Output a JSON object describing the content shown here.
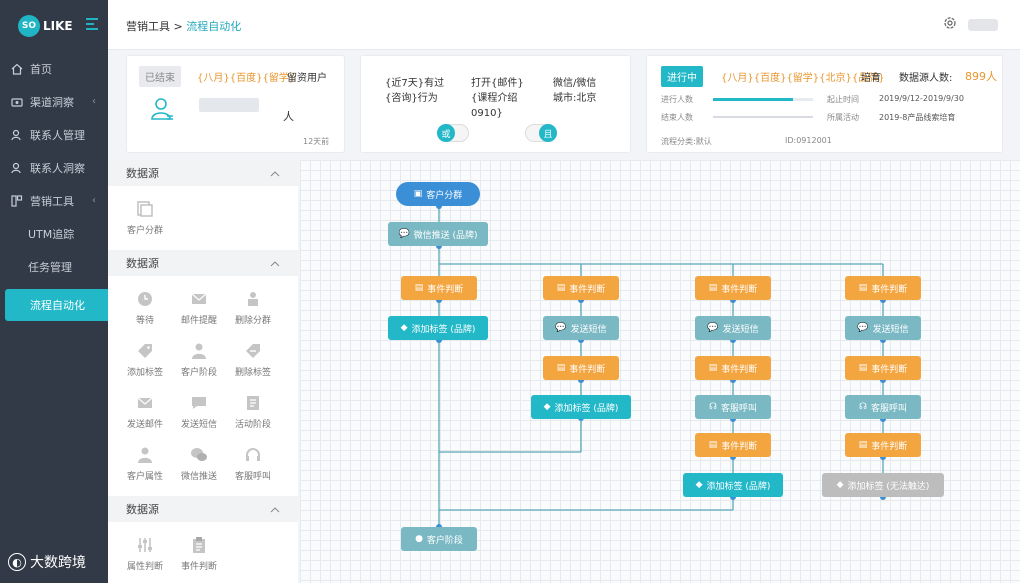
{
  "sidebar": {
    "logo_badge": "SO",
    "logo_text": "LIKE",
    "items": [
      {
        "label": "首页",
        "icon": "home-icon"
      },
      {
        "label": "渠道洞察",
        "icon": "channel-icon"
      },
      {
        "label": "联系人管理",
        "icon": "contact-icon"
      },
      {
        "label": "联系人洞察",
        "icon": "contact-insight-icon"
      },
      {
        "label": "营销工具",
        "icon": "tools-icon"
      },
      {
        "label": "UTM追踪"
      },
      {
        "label": "任务管理"
      },
      {
        "label": "流程自动化"
      }
    ]
  },
  "header": {
    "crumb_parent": "营销工具",
    "crumb_sep": " > ",
    "crumb_current": "流程自动化"
  },
  "card1": {
    "status": "已结束",
    "tags": "{八月}{百度}{留学}",
    "suffix": "留资用户",
    "unit": "人",
    "time": "12天前"
  },
  "card2": {
    "col1": "{近7天}有过\n{咨询}行为",
    "col2": "打开{邮件}\n{课程介绍\n0910}",
    "col3": "微信/微信\n城市:北京",
    "or_label": "或",
    "and_label": "且"
  },
  "card3": {
    "status": "进行中",
    "tags": "{八月}{百度}{留学}{北京}{品牌}",
    "tags_suffix": "培育",
    "count_label": "数据源人数:",
    "count_value": "899人",
    "progress_label": "进行人数",
    "end_label": "结束人数",
    "start_time_label": "起止时间",
    "start_time": "2019/9/12-2019/9/30",
    "activity_label": "所属活动",
    "activity": "2019-8产品线索培育",
    "category": "流程分类:默认",
    "id": "ID:0912001",
    "progress": 0.8
  },
  "palette": {
    "sections": [
      {
        "title": "数据源",
        "items": [
          {
            "label": "客户分群",
            "icon": "segment-icon"
          }
        ]
      },
      {
        "title": "数据源",
        "items": [
          {
            "label": "等待",
            "icon": "clock-icon"
          },
          {
            "label": "邮件提醒",
            "icon": "mail-icon"
          },
          {
            "label": "删除分群",
            "icon": "delete-segment-icon"
          },
          {
            "label": "添加标签",
            "icon": "tag-icon"
          },
          {
            "label": "客户阶段",
            "icon": "person-icon"
          },
          {
            "label": "删除标签",
            "icon": "delete-tag-icon"
          },
          {
            "label": "发送邮件",
            "icon": "send-mail-icon"
          },
          {
            "label": "发送短信",
            "icon": "sms-icon"
          },
          {
            "label": "活动阶段",
            "icon": "stage-icon"
          },
          {
            "label": "客户属性",
            "icon": "attribute-icon"
          },
          {
            "label": "微信推送",
            "icon": "wechat-icon"
          },
          {
            "label": "客服呼叫",
            "icon": "headset-icon"
          }
        ]
      },
      {
        "title": "数据源",
        "items": [
          {
            "label": "属性判断",
            "icon": "slider-icon"
          },
          {
            "label": "事件判断",
            "icon": "clipboard-icon"
          }
        ]
      }
    ]
  },
  "flow": {
    "start": "客户分群",
    "wechat": "微信推送 (品牌)",
    "event": "事件判断",
    "add_tag": "添加标签 (品牌)",
    "sms": "发送短信",
    "call": "客服呼叫",
    "add_tag_disabled": "添加标签 (无法触达)",
    "stage": "客户阶段"
  },
  "watermark": "大数跨境"
}
